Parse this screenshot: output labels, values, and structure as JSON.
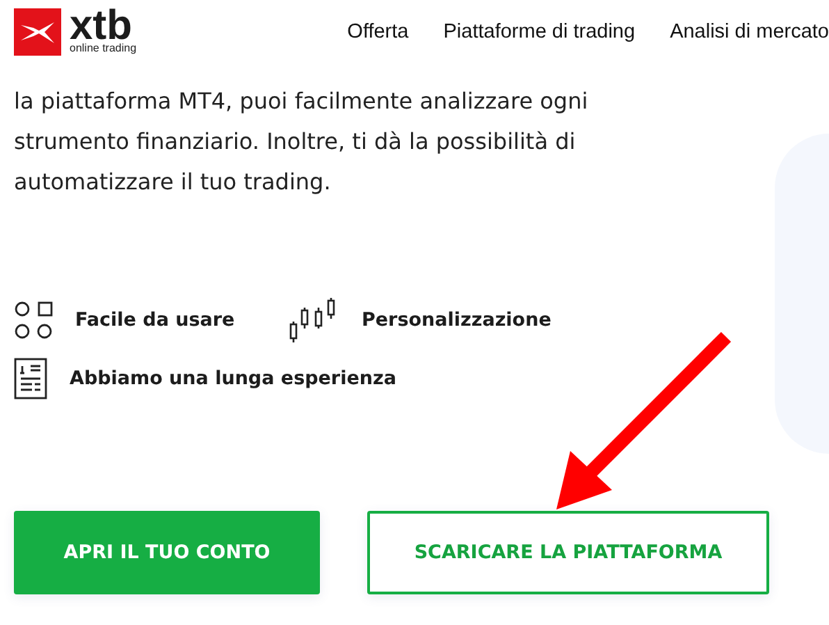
{
  "header": {
    "logo": {
      "wordmark": "xtb",
      "tagline": "online trading"
    },
    "nav": [
      {
        "label": "Offerta"
      },
      {
        "label": "Piattaforme di trading"
      },
      {
        "label": "Analisi di mercato"
      }
    ]
  },
  "intro": "la piattaforma MT4, puoi facilmente analizzare ogni strumento finanziario. Inoltre, ti dà la possibilità di automatizzare il tuo trading.",
  "features": [
    {
      "kind": "shapes",
      "label": "Facile da usare"
    },
    {
      "kind": "candles",
      "label": "Personalizzazione"
    },
    {
      "kind": "document",
      "label": "Abbiamo una lunga esperienza"
    }
  ],
  "buttons": [
    {
      "kind": "primary",
      "label": "APRI IL TUO CONTO"
    },
    {
      "kind": "outline",
      "label": "SCARICARE LA PIATTAFORMA"
    }
  ]
}
